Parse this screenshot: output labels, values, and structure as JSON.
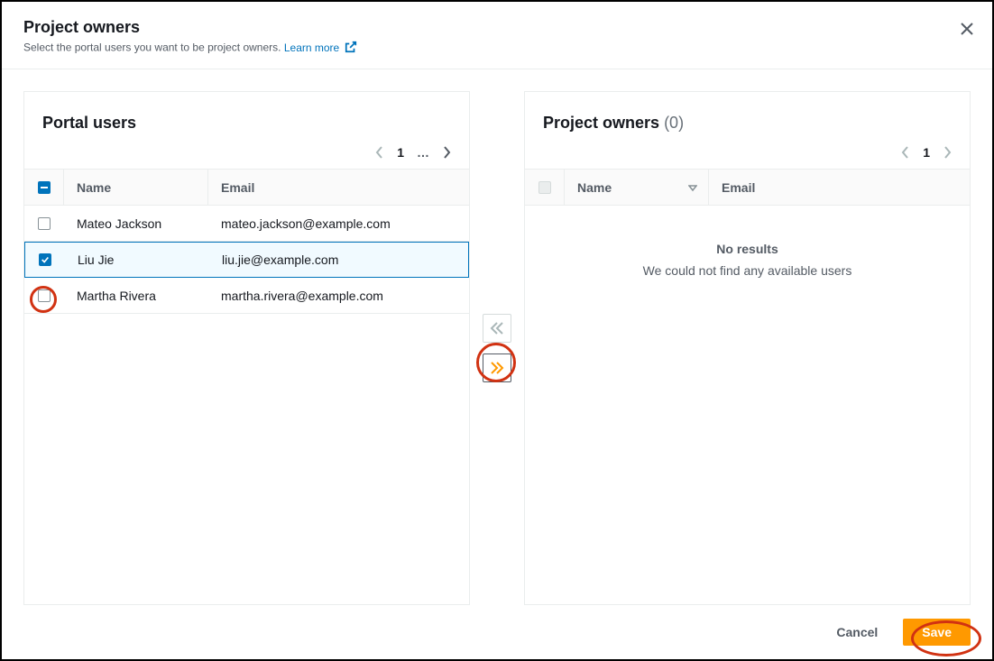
{
  "header": {
    "title": "Project owners",
    "subtitle": "Select the portal users you want to be project owners.",
    "learn_more_label": "Learn more"
  },
  "left_panel": {
    "title": "Portal users",
    "pagination": {
      "current_page": "1",
      "ellipsis": "…"
    },
    "columns": {
      "name": "Name",
      "email": "Email"
    },
    "header_check_state": "intermediate",
    "rows": [
      {
        "checked": false,
        "name": "Mateo Jackson",
        "email": "mateo.jackson@example.com"
      },
      {
        "checked": true,
        "name": "Liu Jie",
        "email": "liu.jie@example.com"
      },
      {
        "checked": false,
        "name": "Martha Rivera",
        "email": "martha.rivera@example.com"
      }
    ]
  },
  "right_panel": {
    "title": "Project owners",
    "count": "(0)",
    "pagination": {
      "current_page": "1"
    },
    "columns": {
      "name": "Name",
      "email": "Email"
    },
    "empty": {
      "title": "No results",
      "message": "We could not find any available users"
    }
  },
  "footer": {
    "cancel_label": "Cancel",
    "save_label": "Save"
  }
}
